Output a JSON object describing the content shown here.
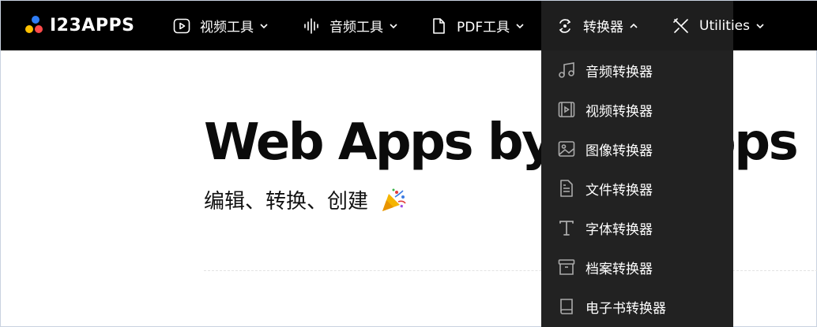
{
  "brand": {
    "name": "I23APPS"
  },
  "nav": {
    "items": [
      {
        "label": "视频工具",
        "icon": "play-icon"
      },
      {
        "label": "音频工具",
        "icon": "waveform-icon"
      },
      {
        "label": "PDF工具",
        "icon": "document-icon"
      },
      {
        "label": "转换器",
        "icon": "convert-icon",
        "expanded": true
      },
      {
        "label": "Utilities",
        "icon": "tools-icon"
      }
    ]
  },
  "hero": {
    "title": "Web Apps by 123apps",
    "subtitle": "编辑、转换、创建",
    "emoji": "party-popper-icon"
  },
  "dropdown": {
    "items": [
      {
        "label": "音频转换器",
        "icon": "music-note-icon"
      },
      {
        "label": "视频转换器",
        "icon": "film-icon"
      },
      {
        "label": "图像转换器",
        "icon": "image-icon"
      },
      {
        "label": "文件转换器",
        "icon": "file-icon"
      },
      {
        "label": "字体转换器",
        "icon": "font-icon"
      },
      {
        "label": "档案转换器",
        "icon": "archive-icon"
      },
      {
        "label": "电子书转换器",
        "icon": "book-icon"
      }
    ]
  },
  "colors": {
    "nav_bg": "#000000",
    "dropdown_bg": "#222222",
    "text_dark": "#0b0b0b"
  }
}
